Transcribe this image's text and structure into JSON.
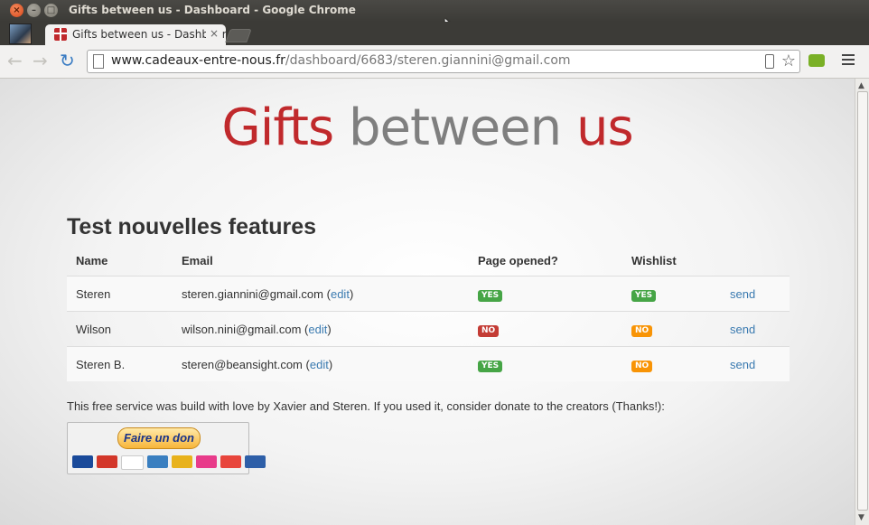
{
  "window": {
    "title": "Gifts between us - Dashboard - Google Chrome"
  },
  "tab": {
    "label": "Gifts between us - Dashboard",
    "close": "×"
  },
  "toolbar": {
    "url_host": "www.cadeaux-entre-nous.fr",
    "url_path": "/dashboard/6683/steren.giannini@gmail.com",
    "back": "←",
    "forward": "→",
    "reload": "↻",
    "star": "☆"
  },
  "logo": {
    "part1": "Gifts",
    "part2": "between",
    "part3": "us"
  },
  "event": {
    "title": "Test nouvelles features"
  },
  "table": {
    "headers": [
      "Name",
      "Email",
      "Page opened?",
      "Wishlist",
      ""
    ],
    "rows": [
      {
        "name": "Steren",
        "email": "steren.giannini@gmail.com",
        "edit": "edit",
        "opened": "YES",
        "wishlist": "YES",
        "send": "send"
      },
      {
        "name": "Wilson",
        "email": "wilson.nini@gmail.com",
        "edit": "edit",
        "opened": "NO",
        "wishlist": "NO",
        "send": "send"
      },
      {
        "name": "Steren B.",
        "email": "steren@beansight.com",
        "edit": "edit",
        "opened": "YES",
        "wishlist": "NO",
        "send": "send"
      }
    ]
  },
  "footer": {
    "text": "This free service was build with love by Xavier and Steren. If you used it, consider donate to the creators (Thanks!):"
  },
  "donate": {
    "label": "Faire un don"
  },
  "colors": {
    "brand_red": "#c0292c",
    "brand_gray": "#7f7f7f",
    "link": "#3a7ab0",
    "yes": "#46a546",
    "no": "#c43c35",
    "warn": "#f89406"
  }
}
